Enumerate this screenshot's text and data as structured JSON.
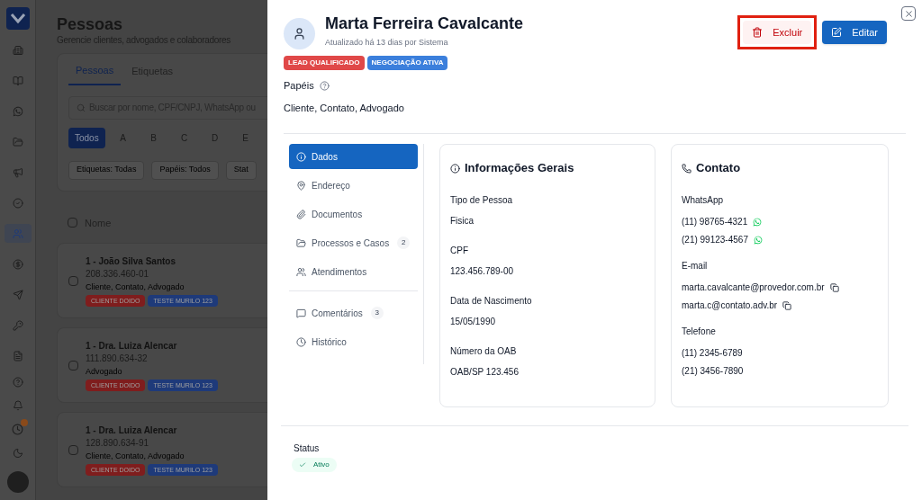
{
  "sidebar_items": [
    {
      "selected": false
    },
    {
      "selected": false
    },
    {
      "selected": false
    },
    {
      "selected": false
    },
    {
      "selected": false
    },
    {
      "selected": false
    },
    {
      "selected": true
    },
    {
      "selected": false
    },
    {
      "selected": false
    },
    {
      "selected": false
    },
    {
      "selected": false
    }
  ],
  "page": {
    "title": "Pessoas",
    "subtitle": "Gerencie clientes, advogados e colaboradores",
    "tabs": [
      {
        "label": "Pessoas",
        "selected": true
      },
      {
        "label": "Etiquetas",
        "selected": false
      }
    ],
    "search": {
      "placeholder": "Buscar por nome, CPF/CNPJ, WhatsApp ou"
    },
    "letters": [
      {
        "label": "Todos",
        "selected": true
      },
      {
        "label": "A",
        "selected": false
      },
      {
        "label": "B",
        "selected": false
      },
      {
        "label": "C",
        "selected": false
      },
      {
        "label": "D",
        "selected": false
      },
      {
        "label": "E",
        "selected": false
      }
    ],
    "filters": [
      "Etiquetas: Todas",
      "Papéis: Todos",
      "Stat"
    ],
    "column": {
      "label": "Nome",
      "checked": false
    },
    "people": [
      {
        "name": "1 - João Silva Santos",
        "document": "208.336.460-01",
        "roles": "Cliente, Contato, Advogado",
        "checked": false,
        "tags": [
          {
            "label": "CLIENTE DOIDO",
            "color": "#7f1d1d"
          },
          {
            "label": "TESTE MURILO 123",
            "color": "#1e3a7a"
          }
        ]
      },
      {
        "name": "1 - Dra. Luiza Alencar",
        "document": "111.890.634-32",
        "roles": "Advogado",
        "checked": false,
        "tags": [
          {
            "label": "CLIENTE DOIDO",
            "color": "#7f1d1d"
          },
          {
            "label": "TESTE MURILO 123",
            "color": "#1e3a7a"
          }
        ]
      },
      {
        "name": "1 - Dra. Luiza Alencar",
        "document": "128.890.634-91",
        "roles": "Cliente, Contato, Advogado",
        "checked": false,
        "tags": [
          {
            "label": "CLIENTE DOIDO",
            "color": "#7f1d1d"
          },
          {
            "label": "TESTE MURILO 123",
            "color": "#1e3a7a"
          }
        ]
      }
    ]
  },
  "modal": {
    "title": "Marta Ferreira Cavalcante",
    "updated": "Atualizado há 13 dias por Sistema",
    "tags": [
      {
        "label": "LEAD QUALIFICADO",
        "color": "#e04848"
      },
      {
        "label": "NEGOCIAÇÃO ATIVA",
        "color": "#3b7fdc"
      }
    ],
    "roles_label": "Papéis",
    "roles": "Cliente, Contato, Advogado",
    "actions": [
      {
        "label": "Excluir",
        "kind": "delete",
        "highlighted": true
      },
      {
        "label": "Editar",
        "kind": "edit",
        "highlighted": false
      }
    ],
    "nav_groups": [
      [
        {
          "label": "Dados",
          "selected": true
        },
        {
          "label": "Endereço",
          "selected": false
        },
        {
          "label": "Documentos",
          "selected": false
        },
        {
          "label": "Processos e Casos",
          "selected": false,
          "count": "2"
        },
        {
          "label": "Atendimentos",
          "selected": false
        }
      ],
      [
        {
          "label": "Comentários",
          "selected": false,
          "count": "3"
        },
        {
          "label": "Histórico",
          "selected": false
        }
      ]
    ],
    "general": {
      "title": "Informações Gerais",
      "fields": [
        {
          "label": "Tipo de Pessoa",
          "value": "Fisica"
        },
        {
          "label": "CPF",
          "value": "123.456.789-00"
        },
        {
          "label": "Data de Nascimento",
          "value": "15/05/1990"
        },
        {
          "label": "Número da OAB",
          "value": "OAB/SP 123.456"
        }
      ]
    },
    "contact": {
      "title": "Contato",
      "sections": [
        {
          "label": "WhatsApp",
          "items": [
            {
              "value": "(11) 98765-4321",
              "kind": "whatsapp"
            },
            {
              "value": "(21) 99123-4567",
              "kind": "whatsapp"
            }
          ]
        },
        {
          "label": "E-mail",
          "items": [
            {
              "value": "marta.cavalcante@provedor.com.br",
              "kind": "copy"
            },
            {
              "value": "marta.c@contato.adv.br",
              "kind": "copy"
            }
          ]
        },
        {
          "label": "Telefone",
          "items": [
            {
              "value": "(11) 2345-6789",
              "kind": "plain"
            },
            {
              "value": "(21) 3456-7890",
              "kind": "plain"
            }
          ]
        }
      ]
    },
    "status": {
      "label": "Status",
      "value": "Ativo"
    }
  }
}
